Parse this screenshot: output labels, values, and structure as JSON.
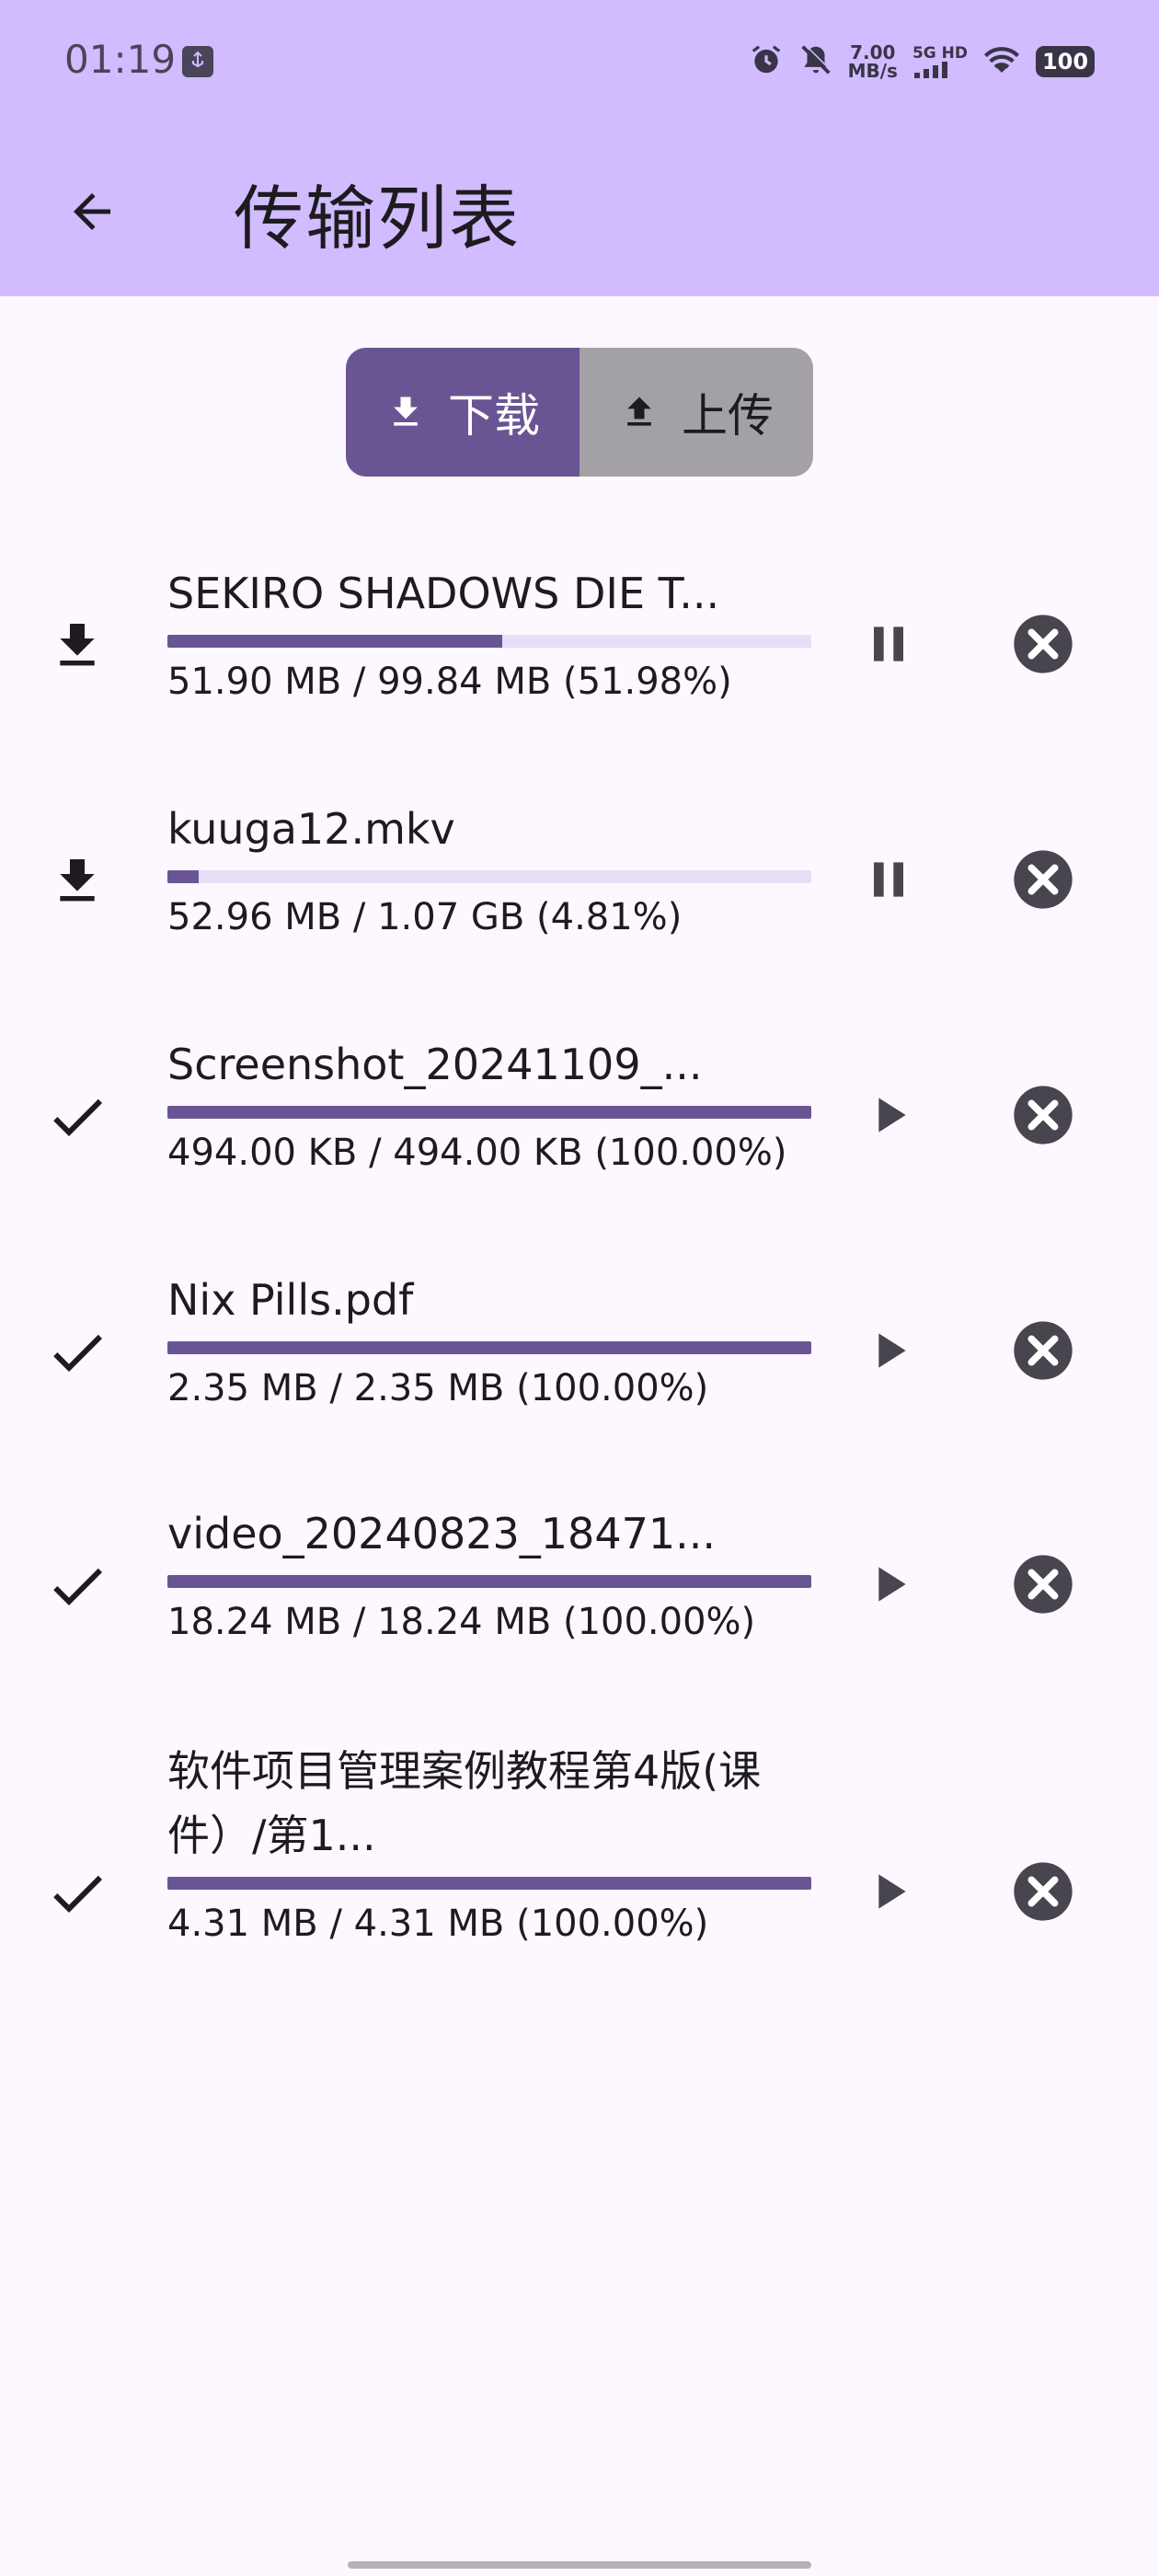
{
  "status_bar": {
    "time": "01:19",
    "net_speed_value": "7.00",
    "net_speed_unit": "MB/s",
    "net_type": "5G HD",
    "battery": "100"
  },
  "appbar": {
    "title": "传输列表"
  },
  "tabs": {
    "download_label": "下载",
    "upload_label": "上传",
    "selected": "下载"
  },
  "colors": {
    "header_bg": "#d0bcff",
    "accent": "#6a5594",
    "track": "#e8def8",
    "page_bg": "#fdf7ff"
  },
  "transfers": [
    {
      "name": "SEKIRO SHADOWS DIE T...",
      "size": "51.90 MB / 99.84 MB (51.98%)",
      "progress": 0.5198,
      "status": "downloading",
      "status_icon": "download-icon",
      "action_icon": "pause-icon"
    },
    {
      "name": "kuuga12.mkv",
      "size": "52.96 MB / 1.07 GB (4.81%)",
      "progress": 0.0481,
      "status": "downloading",
      "status_icon": "download-icon",
      "action_icon": "pause-icon"
    },
    {
      "name": "Screenshot_20241109_...",
      "size": "494.00 KB / 494.00 KB (100.00%)",
      "progress": 1.0,
      "status": "completed",
      "status_icon": "check-icon",
      "action_icon": "play-icon"
    },
    {
      "name": "Nix Pills.pdf",
      "size": "2.35 MB / 2.35 MB (100.00%)",
      "progress": 1.0,
      "status": "completed",
      "status_icon": "check-icon",
      "action_icon": "play-icon"
    },
    {
      "name": "video_20240823_18471...",
      "size": "18.24 MB / 18.24 MB (100.00%)",
      "progress": 1.0,
      "status": "completed",
      "status_icon": "check-icon",
      "action_icon": "play-icon"
    },
    {
      "name": "软件项目管理案例教程第4版(课件）/第1...",
      "size": "4.31 MB / 4.31 MB (100.00%)",
      "progress": 1.0,
      "status": "completed",
      "status_icon": "check-icon",
      "action_icon": "play-icon"
    }
  ]
}
